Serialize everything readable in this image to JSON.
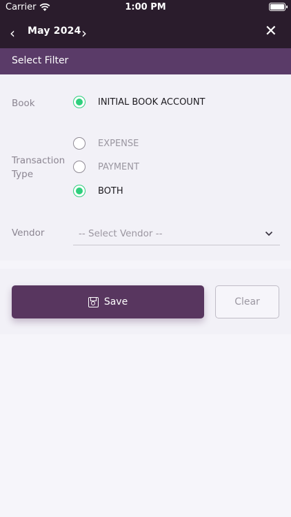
{
  "status_bar": {
    "carrier": "Carrier",
    "time": "1:00 PM"
  },
  "nav": {
    "month": "May 2024"
  },
  "filter_header": {
    "title": "Select Filter"
  },
  "book": {
    "label": "Book",
    "option": "INITIAL BOOK ACCOUNT"
  },
  "transaction_type": {
    "label_line1": "Transaction",
    "label_line2": "Type",
    "options": [
      {
        "label": "EXPENSE"
      },
      {
        "label": "PAYMENT"
      },
      {
        "label": "BOTH"
      }
    ]
  },
  "vendor": {
    "label": "Vendor",
    "placeholder": "-- Select Vendor --"
  },
  "actions": {
    "save_label": "Save",
    "clear_label": "Clear"
  },
  "colors": {
    "accent": "#58365f",
    "selected": "#2fcf7d",
    "header": "#5a3b68"
  }
}
